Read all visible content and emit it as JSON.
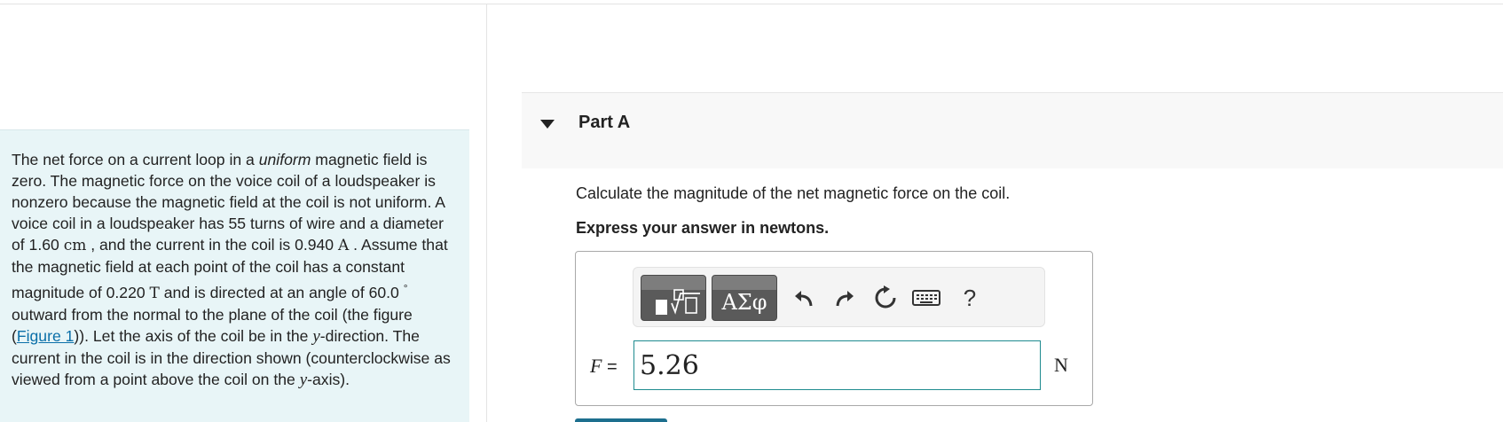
{
  "problem": {
    "t1": "The net force on a current loop in a ",
    "t1_em": "uniform",
    "t2": " magnetic field is zero. The magnetic force on the voice coil of a loudspeaker is nonzero because the magnetic field at the coil is not uniform. A voice coil in a loudspeaker has 55 turns of wire and a diameter of 1.60 ",
    "unit_cm": "cm",
    "t3": " , and the current in the coil is 0.940 ",
    "unit_A": "A",
    "t4": " . Assume that the magnetic field at each point of the coil has a constant magnitude of 0.220 ",
    "unit_T": "T",
    "t5": " and is directed at an angle of 60.0 ",
    "unit_deg": "°",
    "t6": " outward from the normal to the plane of the coil (the figure (",
    "figure_link": "Figure 1",
    "t7": ")). Let the axis of the coil be in the ",
    "var_y1": "y",
    "t8": "-direction. The current in the coil is in the direction shown (counterclockwise as viewed from a point above the coil on the ",
    "var_y2": "y",
    "t9": "-axis)."
  },
  "part": {
    "title": "Part A"
  },
  "question": {
    "prompt": "Calculate the magnitude of the net magnetic force on the coil.",
    "instruction": "Express your answer in newtons."
  },
  "toolbar": {
    "symbols_label": "ΑΣφ",
    "help_label": "?"
  },
  "answer": {
    "variable": "F",
    "equals": " =",
    "value": "5.26",
    "unit": "N"
  },
  "colors": {
    "panel_bg": "#e8f5f7",
    "link": "#0a6fa8",
    "input_border": "#1f8b8f",
    "toolbar_button": "#5a5a5a"
  }
}
